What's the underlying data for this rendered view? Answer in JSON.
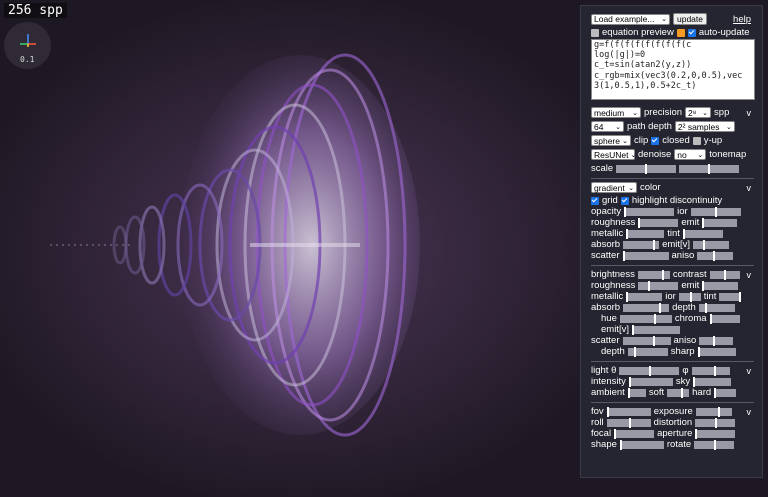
{
  "overlay": {
    "spp": "256 spp",
    "axes_value": "0.1"
  },
  "panel": {
    "load_example": "Load example...",
    "update": "update",
    "help": "help",
    "equation_preview": "equation preview",
    "auto_update": "auto-update",
    "equation_lines": [
      "g=f(f(f(f(f(f(f(f(c",
      "log(|g|)=0",
      "c_t=sin(atan2(y,z))",
      "c_rgb=mix(vec3(0.2,0,0.5),vec",
      "3(1,0.5,1),0.5+2c_t)"
    ],
    "render": {
      "precision_value": "medium",
      "precision_label": "precision",
      "spp_value": "2⁸",
      "spp_label": "spp",
      "path_depth_value": "64",
      "path_depth_label": "path depth",
      "samples_value": "2² samples",
      "clip_value": "sphere",
      "clip_label": "clip",
      "closed_label": "closed",
      "closed": true,
      "yup_label": "y-up",
      "yup": false,
      "denoise_value": "ResUNet",
      "denoise_label": "denoise",
      "tonemap_value": "no",
      "tonemap_label": "tonemap",
      "scale_label": "scale",
      "scale_level_1": 0.5,
      "scale_level_2": 0.5,
      "v": "v"
    },
    "color": {
      "mode_value": "gradient",
      "mode_label": "color",
      "grid_label": "grid",
      "grid": true,
      "highlight_label": "highlight discontinuity",
      "highlight": true,
      "opacity": "opacity",
      "ior": "ior",
      "roughness": "roughness",
      "emit": "emit",
      "metallic": "metallic",
      "tint": "tint",
      "absorb": "absorb",
      "emit_v": "emit[v]",
      "scatter": "scatter",
      "aniso": "aniso",
      "v": "v"
    },
    "material": {
      "brightness": "brightness",
      "contrast": "contrast",
      "roughness": "roughness",
      "emit": "emit",
      "metallic": "metallic",
      "ior": "ior",
      "tint": "tint",
      "absorb": "absorb",
      "depth": "depth",
      "hue": "hue",
      "chroma": "chroma",
      "emit_v": "emit[v]",
      "scatter": "scatter",
      "aniso": "aniso",
      "depth2": "depth",
      "sharp": "sharp",
      "v": "v"
    },
    "light": {
      "theta": "light θ",
      "phi": "φ",
      "intensity": "intensity",
      "sky": "sky",
      "ambient": "ambient",
      "soft": "soft",
      "hard": "hard",
      "v": "v"
    },
    "camera": {
      "fov": "fov",
      "exposure": "exposure",
      "roll": "roll",
      "distortion": "distortion",
      "focal": "focal",
      "aperture": "aperture",
      "shape": "shape",
      "rotate": "rotate",
      "v": "v"
    }
  },
  "colors": {
    "panel_bg": "#242530",
    "accent": "#1a73e8",
    "orange": "#f59b23",
    "slider": "#9a9aa6"
  }
}
